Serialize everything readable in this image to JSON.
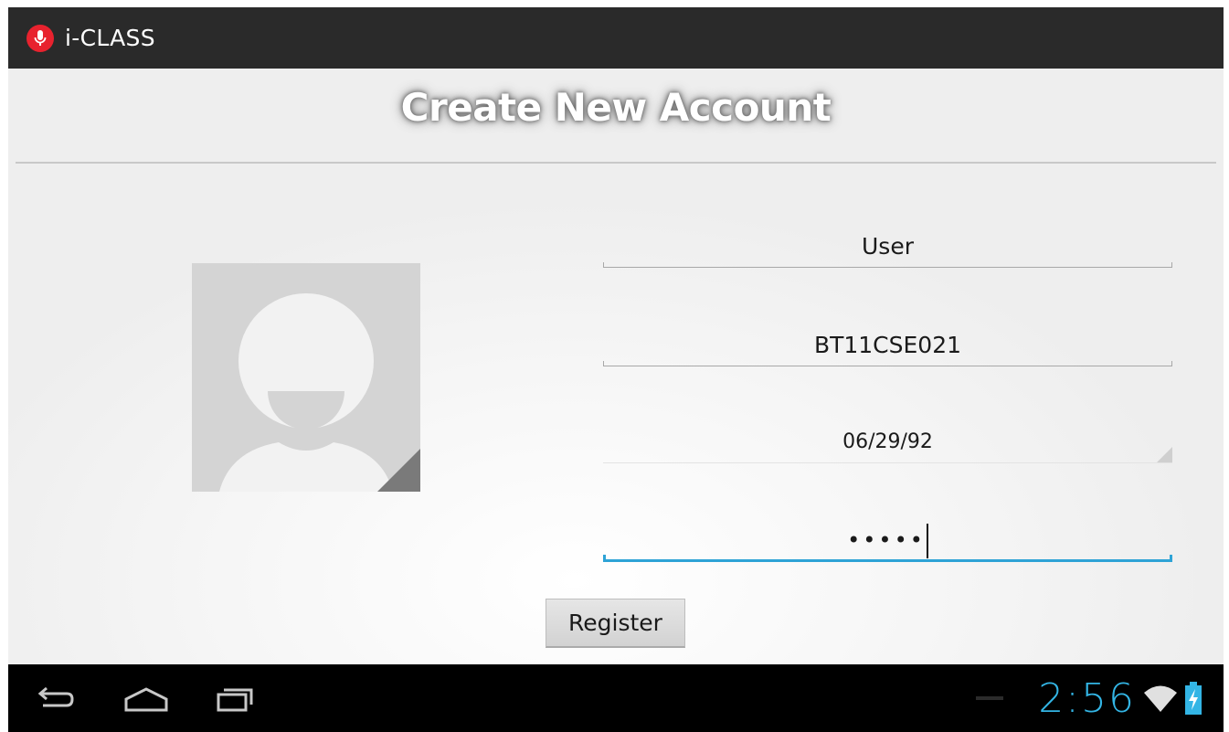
{
  "app": {
    "title": "i-CLASS",
    "icon": "microphone-icon",
    "brand_color": "#e8222e"
  },
  "page": {
    "title": "Create New Account"
  },
  "avatar": {
    "icon": "person-avatar-icon"
  },
  "form": {
    "name_value": "User",
    "id_value": "BT11CSE021",
    "dob_value": "06/29/92",
    "password_value": "•••••",
    "focus_color": "#2ea3d6"
  },
  "register": {
    "label": "Register"
  },
  "navbar": {
    "back_icon": "back-icon",
    "home_icon": "home-icon",
    "recent_icon": "recent-apps-icon"
  },
  "status": {
    "time": "2:56",
    "wifi_icon": "wifi-icon",
    "battery_icon": "battery-charging-icon",
    "accent": "#33b5e5"
  }
}
